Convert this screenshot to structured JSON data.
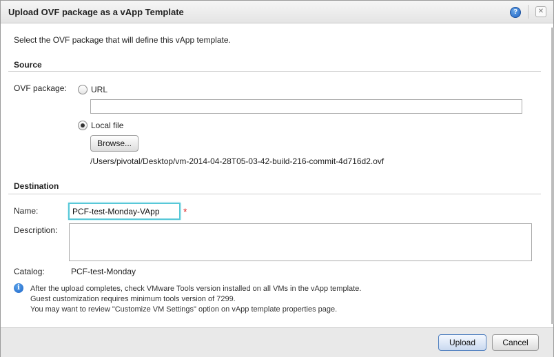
{
  "dialog": {
    "title": "Upload OVF package as a vApp Template",
    "help_icon": "help-icon",
    "close_icon": "close-icon",
    "intro": "Select the OVF package that will define this vApp template."
  },
  "source": {
    "heading": "Source",
    "ovf_label": "OVF package:",
    "url_label": "URL",
    "url_value": "",
    "url_selected": false,
    "local_label": "Local file",
    "local_selected": true,
    "browse_label": "Browse...",
    "file_path": "/Users/pivotal/Desktop/vm-2014-04-28T05-03-42-build-216-commit-4d716d2.ovf"
  },
  "destination": {
    "heading": "Destination",
    "name_label": "Name:",
    "name_value": "PCF-test-Monday-VApp",
    "required_mark": "*",
    "description_label": "Description:",
    "description_value": "",
    "catalog_label": "Catalog:",
    "catalog_value": "PCF-test-Monday"
  },
  "info": {
    "icon": "info-icon",
    "lines": [
      "After the upload completes, check VMware Tools version installed on all VMs in the vApp template.",
      "Guest customization requires minimum tools version of 7299.",
      "You may want to review \"Customize VM Settings\" option on vApp template properties page."
    ]
  },
  "footer": {
    "upload_label": "Upload",
    "cancel_label": "Cancel"
  },
  "colors": {
    "focus_border": "#58c8d8",
    "required": "#dd2222",
    "info_blue": "#1d64c8"
  }
}
